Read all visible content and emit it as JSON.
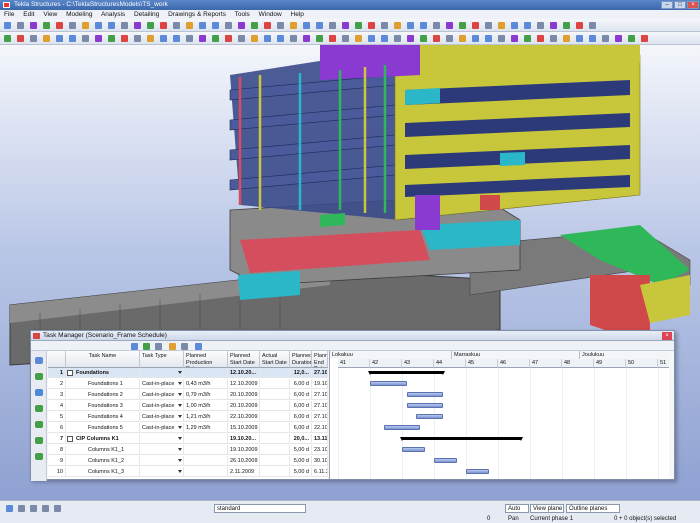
{
  "window": {
    "title": "Tekla Structures - C:\\TeklaStructuresModels\\TS_work"
  },
  "menu": [
    "File",
    "Edit",
    "View",
    "Modeling",
    "Analysis",
    "Detailing",
    "Drawings & Reports",
    "Tools",
    "Window",
    "Help"
  ],
  "task_manager": {
    "title": "Task Manager (Scenario_Frame Schedule)",
    "columns": [
      "",
      "Task Name",
      "Task Type",
      "Planned Production Rate",
      "Planned Start Date",
      "Actual Start Date",
      "Planned Duration",
      "Planned End Date"
    ],
    "rows": [
      {
        "num": "1",
        "name": "Foundations",
        "type": "",
        "rate": "",
        "pstart": "12.10.20...",
        "astart": "",
        "dur": "12,0...",
        "pend": "27.10.20...",
        "bold": true,
        "group": true,
        "selected": true
      },
      {
        "num": "2",
        "name": "Foundations 1",
        "type": "Cast-in-place",
        "rate": "0,43 m3/h",
        "pstart": "12.10.2009",
        "astart": "",
        "dur": "6,00 d",
        "pend": "19.10.2009"
      },
      {
        "num": "3",
        "name": "Foundations 2",
        "type": "Cast-in-place",
        "rate": "0,79 m3/h",
        "pstart": "20.10.2009",
        "astart": "",
        "dur": "6,00 d",
        "pend": "27.10.2009"
      },
      {
        "num": "4",
        "name": "Foundations 3",
        "type": "Cast-in-place",
        "rate": "1,00 m3/h",
        "pstart": "20.10.2009",
        "astart": "",
        "dur": "6,00 d",
        "pend": "27.10.2009"
      },
      {
        "num": "5",
        "name": "Foundations 4",
        "type": "Cast-in-place",
        "rate": "1,21 m3/h",
        "pstart": "22.10.2009",
        "astart": "",
        "dur": "6,00 d",
        "pend": "27.10.2009"
      },
      {
        "num": "6",
        "name": "Foundations 5",
        "type": "Cast-in-place",
        "rate": "1,29 m3/h",
        "pstart": "15.10.2009",
        "astart": "",
        "dur": "6,00 d",
        "pend": "22.10.2009"
      },
      {
        "num": "7",
        "name": "CIP Columns K1",
        "type": "",
        "rate": "",
        "pstart": "19.10.20...",
        "astart": "",
        "dur": "20,0...",
        "pend": "13.11.20...",
        "bold": true,
        "group": true
      },
      {
        "num": "8",
        "name": "Columns K1_1",
        "type": "",
        "rate": "",
        "pstart": "19.10.2009",
        "astart": "",
        "dur": "5,00 d",
        "pend": "23.10.2009"
      },
      {
        "num": "9",
        "name": "Columns K1_2",
        "type": "",
        "rate": "",
        "pstart": "26.10.2009",
        "astart": "",
        "dur": "5,00 d",
        "pend": "30.10.2009"
      },
      {
        "num": "10",
        "name": "Columns K1_3",
        "type": "",
        "rate": "",
        "pstart": "2.11.2009",
        "astart": "",
        "dur": "5,00 d",
        "pend": "6.11.2009"
      }
    ],
    "months": [
      "Lokakuu",
      "Marraskuu",
      "Joulukuu"
    ],
    "weeks": [
      "41",
      "42",
      "43",
      "44",
      "45",
      "46",
      "47",
      "48",
      "49",
      "50",
      "51"
    ]
  },
  "statusbar": {
    "standard_value": "standard",
    "auto": "Auto",
    "view_plane": "View plane",
    "outline_planes": "Outline planes",
    "mode": "Pan",
    "phase": "Current phase 1",
    "selection": "0 + 0 object(s) selected",
    "left_num": "0"
  },
  "colors": {
    "titlebar": "#3b68ad",
    "bar_fill": "#8aa2da",
    "summary_bar": "#000000",
    "building_yellow": "#c8c63a",
    "building_purple": "#8a3ad0",
    "building_cyan": "#2ab8c8"
  }
}
